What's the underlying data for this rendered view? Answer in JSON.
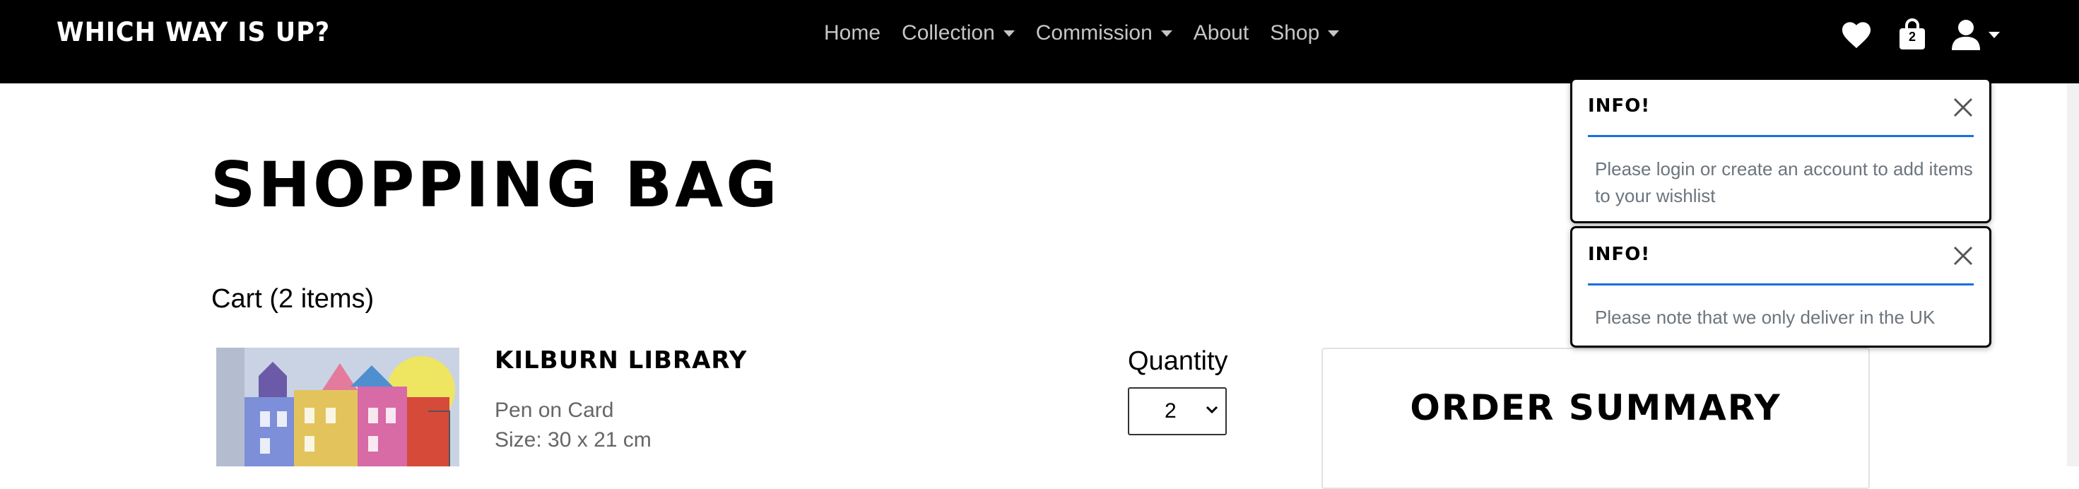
{
  "navbar": {
    "brand": "Which Way Is Up?",
    "links": [
      {
        "label": "Home",
        "dropdown": false
      },
      {
        "label": "Collection",
        "dropdown": true
      },
      {
        "label": "Commission",
        "dropdown": true
      },
      {
        "label": "About",
        "dropdown": false
      },
      {
        "label": "Shop",
        "dropdown": true
      }
    ],
    "icons": {
      "wishlist": "heart-icon",
      "bag": "shopping-bag-icon",
      "bag_count": "2",
      "account": "user-icon"
    }
  },
  "main": {
    "title": "Shopping Bag",
    "cart_count": "Cart (2 items)",
    "item": {
      "name": "Kilburn Library",
      "medium": "Pen on Card",
      "size": "Size: 30 x 21 cm",
      "quantity_label": "Quantity",
      "quantity_value": "2"
    },
    "summary_title": "Order Summary"
  },
  "toasts": [
    {
      "title": "Info!",
      "message": "Please login or create an account to add items to your wishlist"
    },
    {
      "title": "Info!",
      "message": "Please note that we only deliver in the UK"
    }
  ],
  "colors": {
    "navbar_bg": "#000000",
    "nav_text": "#c6c6c6",
    "toast_accent": "#1a6fe0",
    "muted_text": "#6c757d"
  }
}
